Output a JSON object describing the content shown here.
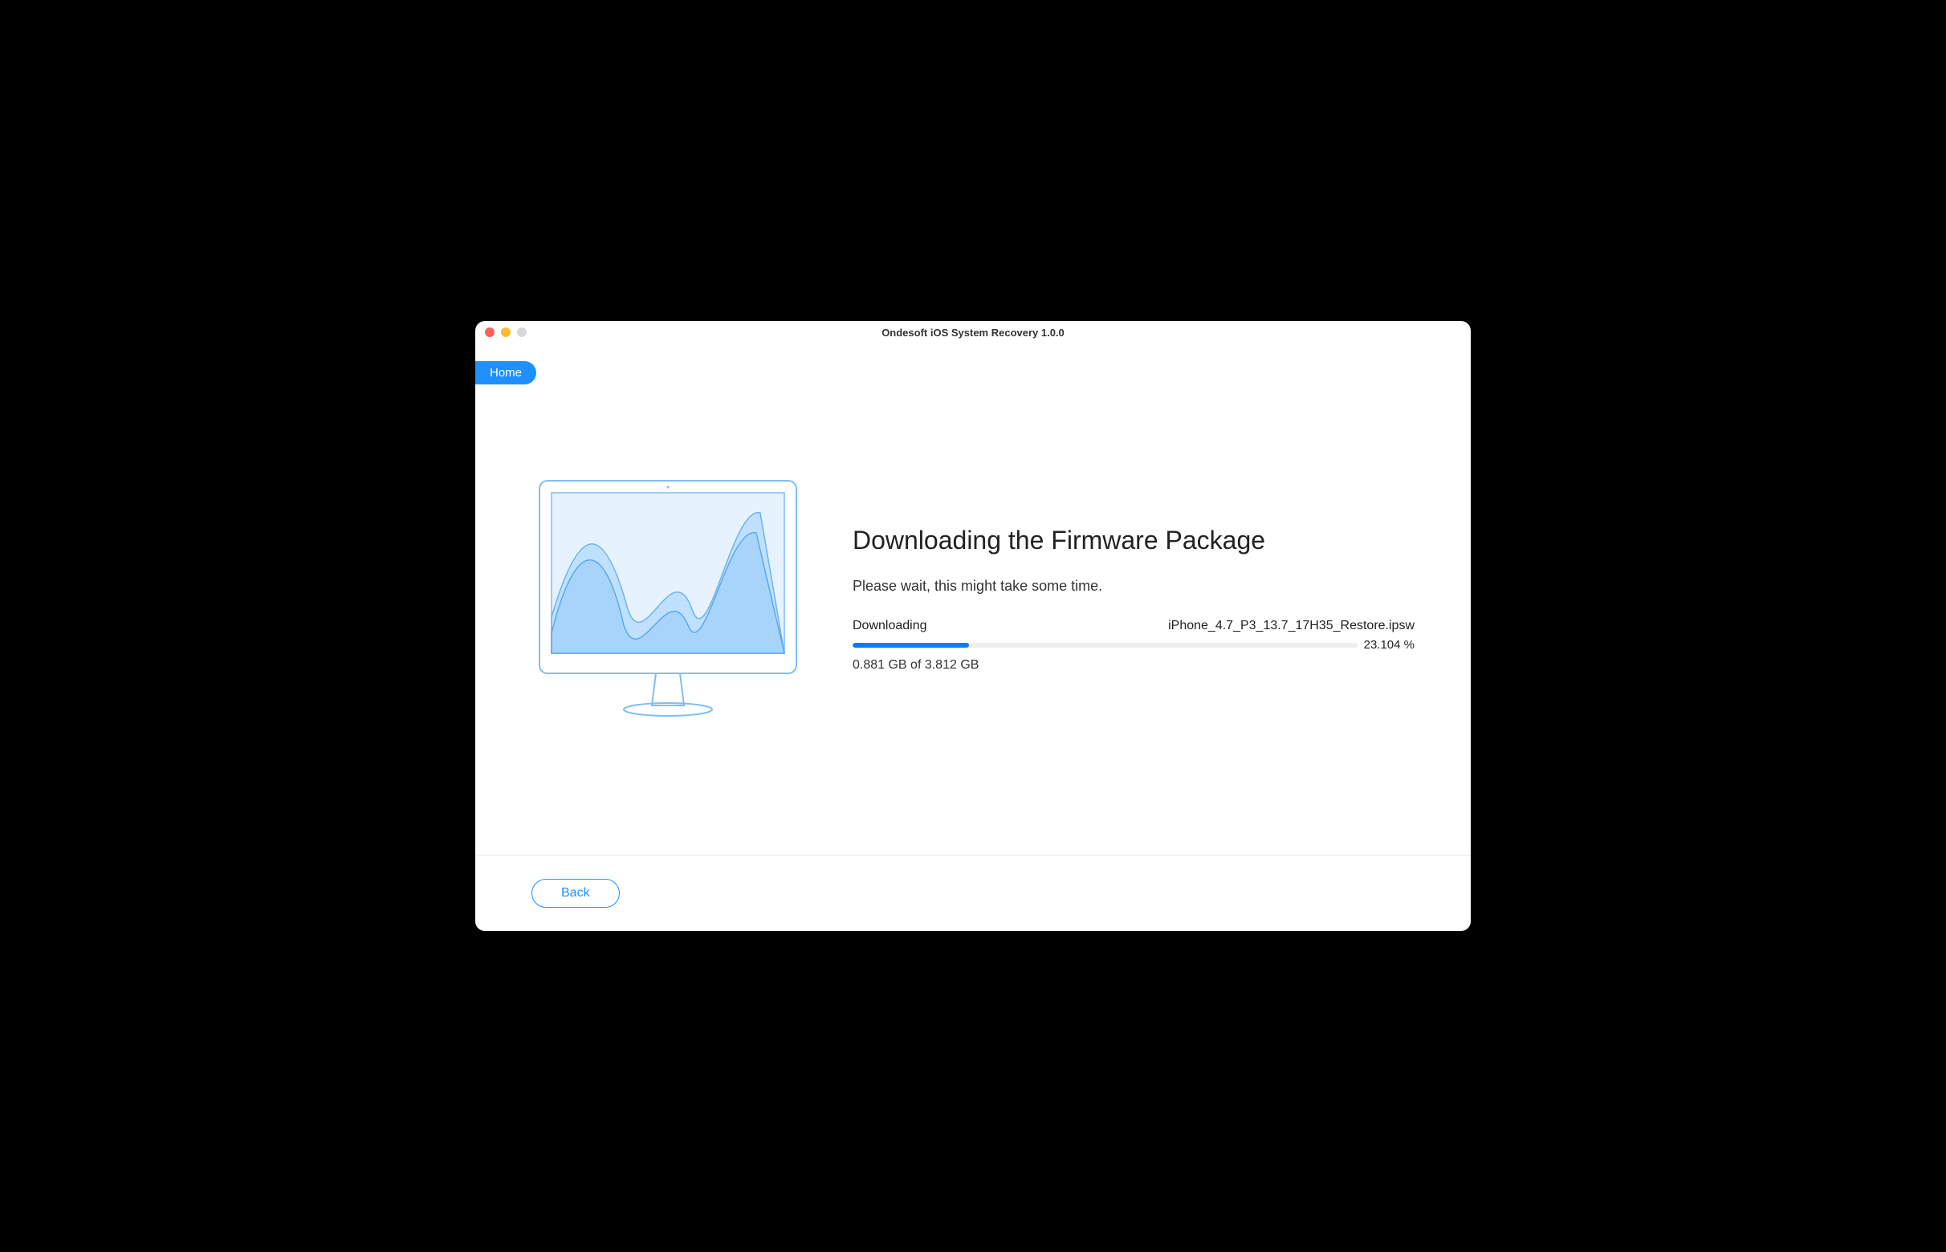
{
  "window": {
    "title": "Ondesoft iOS System Recovery 1.0.0"
  },
  "nav": {
    "home_label": "Home"
  },
  "main": {
    "heading": "Downloading the Firmware Package",
    "subtext": "Please wait, this might take some time.",
    "status_label": "Downloading",
    "file_name": "iPhone_4.7_P3_13.7_17H35_Restore.ipsw",
    "percent_text": "23.104 %",
    "progress_percent": 23.104,
    "size_text": "0.881 GB of 3.812 GB"
  },
  "footer": {
    "back_label": "Back"
  },
  "colors": {
    "accent": "#1e90ff",
    "progress": "#0a7dff"
  }
}
